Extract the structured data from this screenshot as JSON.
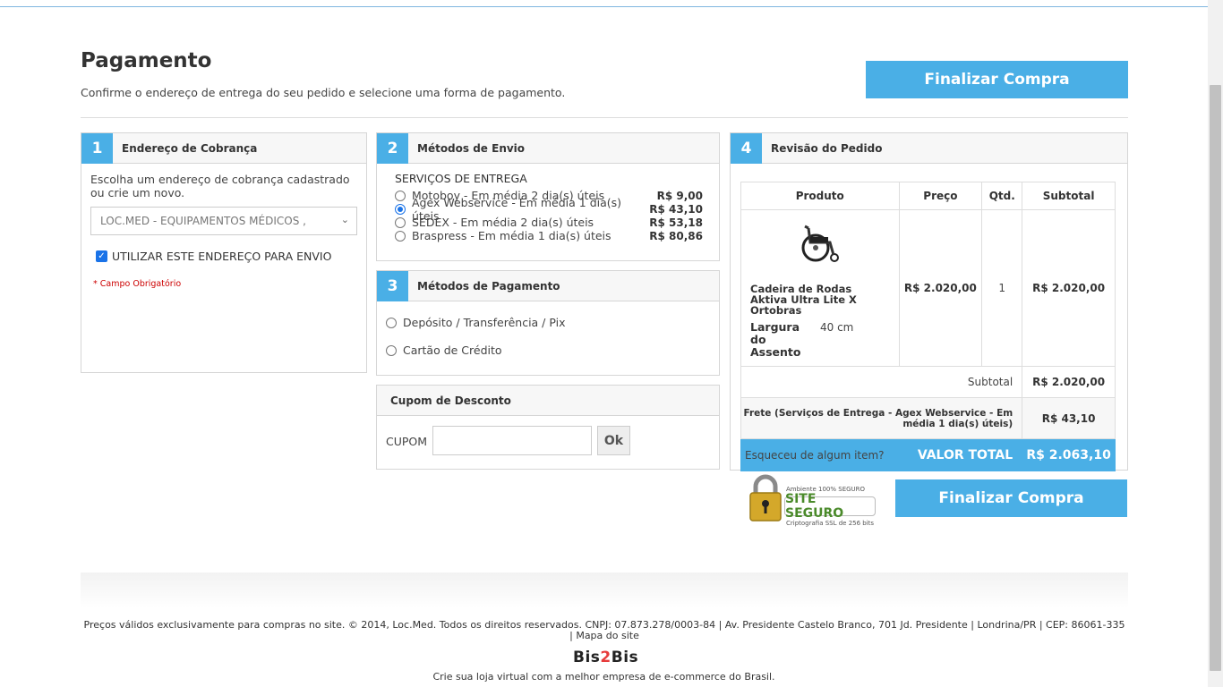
{
  "page": {
    "title": "Pagamento",
    "subtitle": "Confirme o endereço de entrega do seu pedido e selecione uma forma de pagamento.",
    "finalize_label": "Finalizar Compra"
  },
  "billing": {
    "number": "1",
    "title": "Endereço de Cobrança",
    "text": "Escolha um endereço de cobrança cadastrado ou crie um novo.",
    "selected_address": "LOC.MED - EQUIPAMENTOS MÉDICOS ,",
    "use_for_shipping_label": "UTILIZAR ESTE ENDEREÇO PARA ENVIO",
    "use_for_shipping_checked": true,
    "required_note": "* Campo Obrigatório"
  },
  "shipping": {
    "number": "2",
    "title": "Métodos de Envio",
    "group_label": "SERVIÇOS DE ENTREGA",
    "options": [
      {
        "name": "Motoboy - Em média 2 dia(s) úteis",
        "price": "R$ 9,00",
        "selected": false
      },
      {
        "name": "Agex Webservice - Em média 1 dia(s) úteis",
        "price": "R$ 43,10",
        "selected": true
      },
      {
        "name": "SEDEX - Em média 2 dia(s) úteis",
        "price": "R$ 53,18",
        "selected": false
      },
      {
        "name": "Braspress - Em média 1 dia(s) úteis",
        "price": "R$ 80,86",
        "selected": false
      }
    ]
  },
  "payment": {
    "number": "3",
    "title": "Métodos de Pagamento",
    "options": [
      {
        "name": "Depósito / Transferência / Pix",
        "selected": false
      },
      {
        "name": "Cartão de Crédito",
        "selected": false
      }
    ]
  },
  "coupon": {
    "title": "Cupom de Desconto",
    "label": "CUPOM",
    "value": "",
    "button": "Ok"
  },
  "review": {
    "number": "4",
    "title": "Revisão do Pedido",
    "columns": [
      "Produto",
      "Preço",
      "Qtd.",
      "Subtotal"
    ],
    "item": {
      "name": "Cadeira de Rodas Aktiva Ultra Lite X Ortobras",
      "attr_label": "Largura do Assento",
      "attr_value": "40 cm",
      "price": "R$ 2.020,00",
      "qty": "1",
      "subtotal": "R$ 2.020,00"
    },
    "subtotal_label": "Subtotal",
    "subtotal_value": "R$ 2.020,00",
    "freight_label": "Frete (Serviços de Entrega - Agex Webservice - Em média 1 dia(s) úteis)",
    "freight_value": "R$ 43,10",
    "total_label": "VALOR TOTAL",
    "total_value": "R$ 2.063,10",
    "forgot_link": "Esqueceu de algum item?"
  },
  "seal": {
    "line1": "Ambiente 100% SEGURO",
    "line2": "SITE SEGURO",
    "line3": "Criptografia SSL de 256 bits"
  },
  "footer": {
    "text": "Preços válidos exclusivamente para compras no site. © 2014, Loc.Med. Todos os direitos reservados. CNPJ: 07.873.278/0003-84 | Av. Presidente Castelo Branco, 701 Jd. Presidente | Londrina/PR | CEP: 86061-335 | Mapa do site",
    "logo_part1": "Bis",
    "logo_part2": "2",
    "logo_part3": "Bis",
    "tagline": "Crie sua loja virtual com a melhor empresa de e-commerce do Brasil."
  },
  "colors": {
    "accent": "#4aafe6",
    "required": "#cc0000"
  }
}
